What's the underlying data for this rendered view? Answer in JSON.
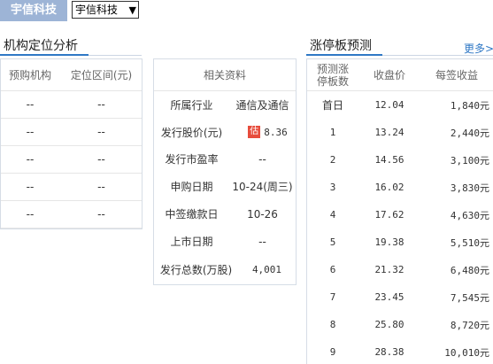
{
  "header": {
    "stock_tag": "宇信科技",
    "stock_select": "宇信科技"
  },
  "institution": {
    "title": "机构定位分析",
    "columns": [
      "预购机构",
      "定位区间(元)"
    ],
    "rows": [
      [
        "--",
        "--"
      ],
      [
        "--",
        "--"
      ],
      [
        "--",
        "--"
      ],
      [
        "--",
        "--"
      ],
      [
        "--",
        "--"
      ]
    ]
  },
  "related": {
    "title": "相关资料",
    "rows": [
      {
        "label": "所属行业",
        "value": "通信及通信"
      },
      {
        "label": "发行股价(元)",
        "badge": "估",
        "value": "8.36"
      },
      {
        "label": "发行市盈率",
        "value": "--"
      },
      {
        "label": "申购日期",
        "value": "10-24(周三)"
      },
      {
        "label": "中签缴款日",
        "value": "10-26"
      },
      {
        "label": "上市日期",
        "value": "--"
      },
      {
        "label": "发行总数(万股)",
        "value": "4,001"
      }
    ]
  },
  "limitup": {
    "title": "涨停板预测",
    "more": "更多>>",
    "columns": [
      "预测涨停板数",
      "收盘价",
      "每签收益"
    ],
    "rows": [
      [
        "首日",
        "12.04",
        "1,840元"
      ],
      [
        "1",
        "13.24",
        "2,440元"
      ],
      [
        "2",
        "14.56",
        "3,100元"
      ],
      [
        "3",
        "16.02",
        "3,830元"
      ],
      [
        "4",
        "17.62",
        "4,630元"
      ],
      [
        "5",
        "19.38",
        "5,510元"
      ],
      [
        "6",
        "21.32",
        "6,480元"
      ],
      [
        "7",
        "23.45",
        "7,545元"
      ],
      [
        "8",
        "25.80",
        "8,720元"
      ],
      [
        "9",
        "28.38",
        "10,010元"
      ]
    ]
  }
}
